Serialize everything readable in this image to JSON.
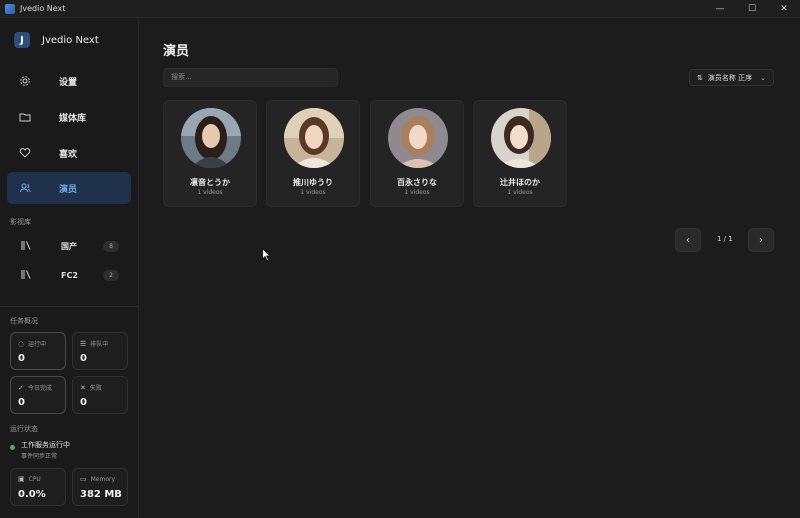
{
  "window": {
    "title": "Jvedio Next",
    "minimize": "—",
    "maximize": "☐",
    "close": "✕"
  },
  "sidebar": {
    "brand": "Jvedio Next",
    "nav": [
      {
        "label": "设置",
        "icon": "gear-icon",
        "glyph": "⚙"
      },
      {
        "label": "媒体库",
        "icon": "folder-icon",
        "glyph": "🗀"
      },
      {
        "label": "喜欢",
        "icon": "heart-icon",
        "glyph": "♡"
      },
      {
        "label": "演员",
        "icon": "users-icon",
        "glyph": "⚇"
      }
    ],
    "libraries_label": "影视库",
    "libraries": [
      {
        "label": "国产",
        "count": "8"
      },
      {
        "label": "FC2",
        "count": "2"
      }
    ],
    "tasks_label": "任务概况",
    "tasks": {
      "running": {
        "label": "运行中",
        "value": "0",
        "glyph": "◌"
      },
      "queued": {
        "label": "排队中",
        "value": "0",
        "glyph": "☰"
      },
      "done_today": {
        "label": "今日完成",
        "value": "0",
        "glyph": "✓"
      },
      "failed": {
        "label": "失败",
        "value": "0",
        "glyph": "✕"
      }
    },
    "status_label": "运行状态",
    "status": {
      "title": "工作服务运行中",
      "subtitle": "事件同步正常"
    },
    "cpu": {
      "label": "CPU",
      "value": "0.0%"
    },
    "memory": {
      "label": "Memory",
      "value": "382 MB"
    }
  },
  "main": {
    "title": "演员",
    "search_placeholder": "搜索...",
    "sort_label": "演员名称 正序",
    "actors": [
      {
        "name": "凛音とうか",
        "videos": "1 videos"
      },
      {
        "name": "推川ゆうり",
        "videos": "1 videos"
      },
      {
        "name": "百永さりな",
        "videos": "1 videos"
      },
      {
        "name": "辻井ほのか",
        "videos": "1 videos"
      }
    ],
    "pager": {
      "text": "1 / 1",
      "prev": "‹",
      "next": "›"
    }
  },
  "colors": {
    "accent": "#6da9ef",
    "active_bg": "#20324b",
    "ok": "#4caf50"
  }
}
